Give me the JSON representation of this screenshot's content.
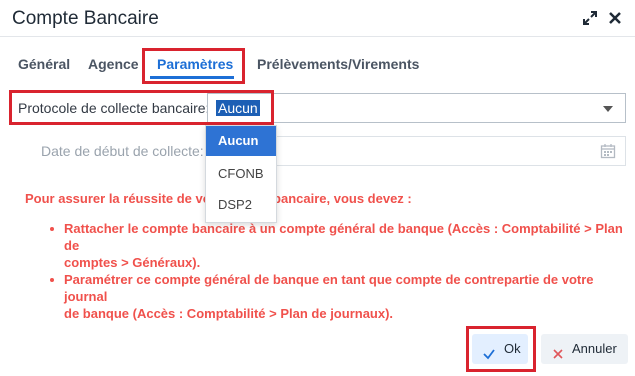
{
  "window": {
    "title": "Compte Bancaire"
  },
  "tabs": [
    {
      "label": "Général"
    },
    {
      "label": "Agence"
    },
    {
      "label": "Paramètres",
      "active": true
    },
    {
      "label": "Prélèvements/Virements"
    }
  ],
  "form": {
    "protocol_label": "Protocole de collecte bancaire:",
    "protocol_value": "Aucun",
    "start_date_label": "Date de début de collecte:",
    "start_date_value": ""
  },
  "dropdown": {
    "options": [
      "Aucun",
      "CFONB",
      "DSP2"
    ],
    "selected": "Aucun"
  },
  "message": {
    "intro_visible_left": "Pour assurer la réussite de vot",
    "intro_visible_right": "bancaire, vous devez :",
    "bullet1_line1_left": "Rattacher le compte bancaire à un compte général de banque (Accès : Comptabilité > Plan de",
    "bullet1_line2": "comptes > Généraux).",
    "bullet2_line1": "Paramétrer ce compte général de banque en tant que compte de contrepartie de votre journal",
    "bullet2_line2": "de banque (Accès : Comptabilité > Plan de journaux)."
  },
  "buttons": {
    "ok": "Ok",
    "cancel": "Annuler"
  },
  "colors": {
    "accent": "#1d6fd6",
    "warning": "#f0514c",
    "highlight": "#d9232e"
  }
}
